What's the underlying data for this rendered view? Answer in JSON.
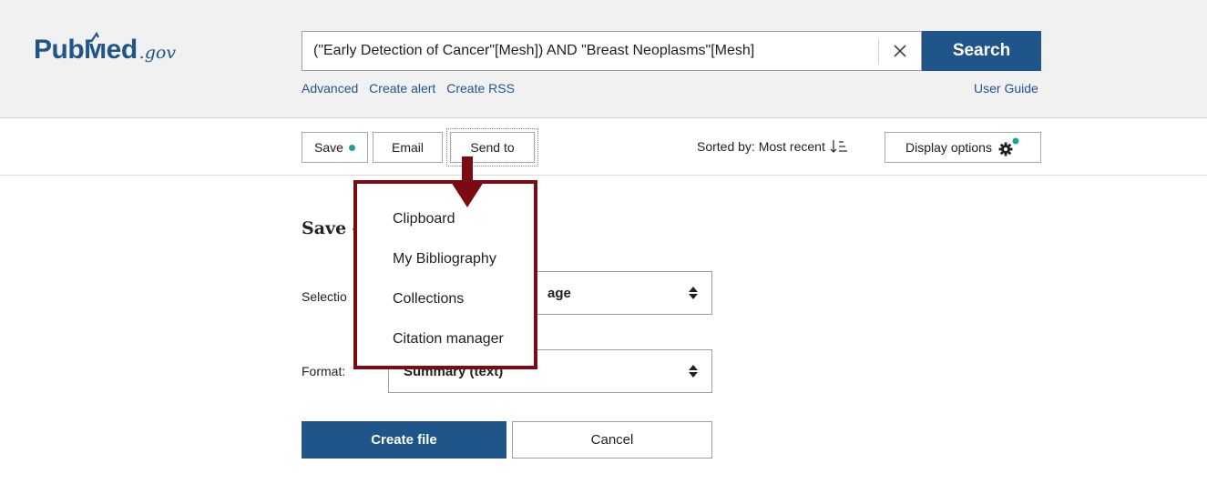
{
  "logo": {
    "pub": "Pub",
    "med": "Med",
    "gov": ".gov"
  },
  "search": {
    "query": "(\"Early Detection of Cancer\"[Mesh]) AND \"Breast Neoplasms\"[Mesh]",
    "button_label": "Search",
    "links": [
      "Advanced",
      "Create alert",
      "Create RSS"
    ],
    "user_guide": "User Guide"
  },
  "toolbar": {
    "save_label": "Save",
    "email_label": "Email",
    "send_to_label": "Send to",
    "sorted_label": "Sorted by: Most recent",
    "display_options_label": "Display options"
  },
  "send_to_menu": {
    "items": [
      "Clipboard",
      "My Bibliography",
      "Collections",
      "Citation manager"
    ]
  },
  "save_panel": {
    "title_visible": "Save c",
    "selection_label_visible": "Selectio",
    "selection_value_visible": "age",
    "format_label": "Format:",
    "format_value_visible": "Summary (text)",
    "create_button": "Create file",
    "cancel_button": "Cancel"
  },
  "colors": {
    "brand_blue": "#20558a",
    "link_blue": "#205493",
    "status_dot": "#1aa29b",
    "highlight_border": "#7a0b12"
  }
}
